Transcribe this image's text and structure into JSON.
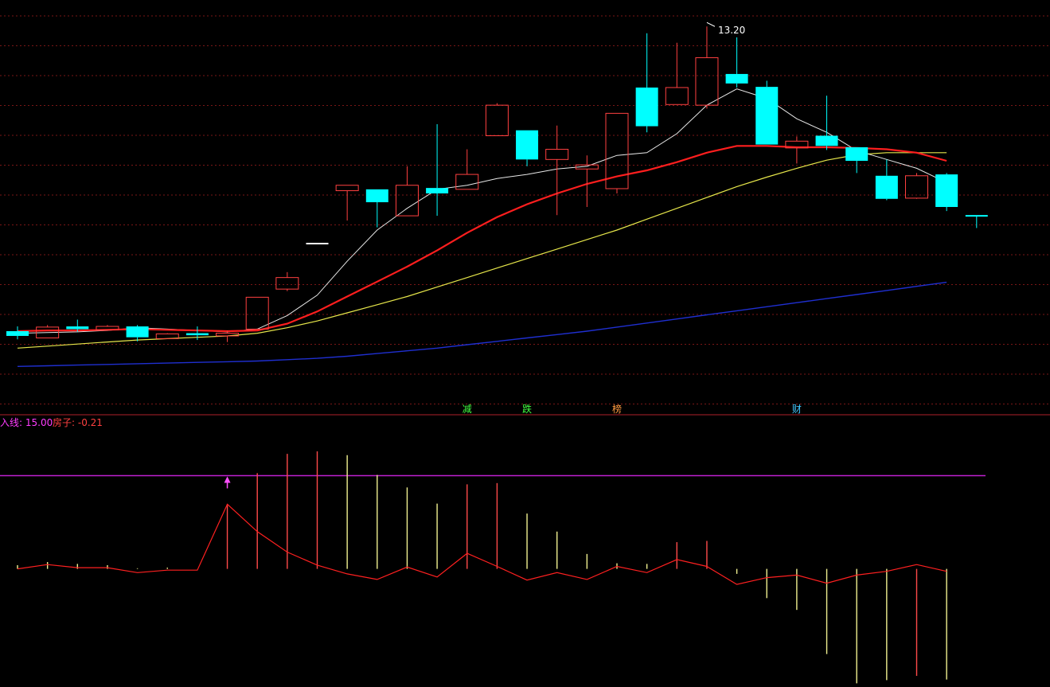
{
  "colors": {
    "background": "#000000",
    "grid": "#7a1616",
    "divider": "#b0202a",
    "up": "#ff4040",
    "down": "#00ffff",
    "ma5": "#e8e8e8",
    "ma10": "#ff1e1e",
    "ma20": "#e6e64a",
    "ma60": "#1f2fd0",
    "sub_line": "#ff2020",
    "ref_line": "#c020d0",
    "bar_up": "#ff4a4a",
    "bar_yellow": "#f0f090",
    "marker": "#ff50ff",
    "label_magenta": "#ff3cff",
    "label_red": "#ff4040"
  },
  "indicator_legend": {
    "entry_label": "入线: 15.00",
    "house_label": "房子: -0.21"
  },
  "price_high_label": "13.20",
  "signal_labels": [
    {
      "text": "减",
      "color": "#40ff40",
      "index": 15
    },
    {
      "text": "跌",
      "color": "#40ff40",
      "index": 17
    },
    {
      "text": "榜",
      "color": "#ff9a40",
      "index": 20
    },
    {
      "text": "财",
      "color": "#40c8ff",
      "index": 26
    }
  ],
  "chart_data": [
    {
      "type": "candlestick",
      "title": "",
      "ylim": [
        7.25,
        13.35
      ],
      "candles": [
        {
          "o": 8.47,
          "h": 8.54,
          "l": 8.35,
          "c": 8.4
        },
        {
          "o": 8.37,
          "h": 8.56,
          "l": 8.37,
          "c": 8.53
        },
        {
          "o": 8.54,
          "h": 8.64,
          "l": 8.46,
          "c": 8.5
        },
        {
          "o": 8.49,
          "h": 8.56,
          "l": 8.49,
          "c": 8.54
        },
        {
          "o": 8.54,
          "h": 8.56,
          "l": 8.32,
          "c": 8.38
        },
        {
          "o": 8.36,
          "h": 8.44,
          "l": 8.36,
          "c": 8.43
        },
        {
          "o": 8.44,
          "h": 8.54,
          "l": 8.34,
          "c": 8.41
        },
        {
          "o": 8.4,
          "h": 8.48,
          "l": 8.31,
          "c": 8.44
        },
        {
          "o": 8.5,
          "h": 8.97,
          "l": 8.5,
          "c": 8.97
        },
        {
          "o": 9.09,
          "h": 9.34,
          "l": 9.06,
          "c": 9.26
        },
        {
          "o": 9.76,
          "h": 9.76,
          "l": 9.76,
          "c": 9.76
        },
        {
          "o": 10.54,
          "h": 10.62,
          "l": 10.1,
          "c": 10.62
        },
        {
          "o": 10.56,
          "h": 10.56,
          "l": 10.0,
          "c": 10.37
        },
        {
          "o": 10.17,
          "h": 10.9,
          "l": 10.17,
          "c": 10.62
        },
        {
          "o": 10.58,
          "h": 11.52,
          "l": 10.17,
          "c": 10.5
        },
        {
          "o": 10.56,
          "h": 11.15,
          "l": 10.56,
          "c": 10.78
        },
        {
          "o": 11.35,
          "h": 11.83,
          "l": 11.35,
          "c": 11.8
        },
        {
          "o": 11.43,
          "h": 11.43,
          "l": 10.9,
          "c": 11.0
        },
        {
          "o": 11.0,
          "h": 11.5,
          "l": 10.18,
          "c": 11.15
        },
        {
          "o": 10.86,
          "h": 11.06,
          "l": 10.3,
          "c": 10.92
        },
        {
          "o": 10.57,
          "h": 11.68,
          "l": 10.5,
          "c": 11.68
        },
        {
          "o": 12.06,
          "h": 12.86,
          "l": 11.4,
          "c": 11.49
        },
        {
          "o": 11.81,
          "h": 12.72,
          "l": 11.81,
          "c": 12.06
        },
        {
          "o": 11.8,
          "h": 12.96,
          "l": 11.75,
          "c": 12.5
        },
        {
          "o": 12.26,
          "h": 12.8,
          "l": 12.06,
          "c": 12.12
        },
        {
          "o": 12.07,
          "h": 12.16,
          "l": 11.22,
          "c": 11.22
        },
        {
          "o": 11.17,
          "h": 11.34,
          "l": 10.94,
          "c": 11.27
        },
        {
          "o": 11.35,
          "h": 11.94,
          "l": 11.14,
          "c": 11.2
        },
        {
          "o": 11.18,
          "h": 11.16,
          "l": 10.8,
          "c": 10.98
        },
        {
          "o": 10.76,
          "h": 11.0,
          "l": 10.4,
          "c": 10.42
        },
        {
          "o": 10.43,
          "h": 10.8,
          "l": 10.42,
          "c": 10.76
        },
        {
          "o": 10.78,
          "h": 10.8,
          "l": 10.24,
          "c": 10.3
        },
        {
          "o": 10.17,
          "h": 10.17,
          "l": 9.99,
          "c": 10.16
        }
      ],
      "ma5": [
        8.44,
        8.45,
        8.46,
        8.48,
        8.52,
        8.5,
        8.48,
        8.46,
        8.5,
        8.7,
        9.0,
        9.5,
        9.96,
        10.28,
        10.56,
        10.62,
        10.72,
        10.78,
        10.86,
        10.9,
        11.06,
        11.1,
        11.38,
        11.8,
        12.04,
        11.9,
        11.6,
        11.4,
        11.13,
        11.0,
        10.87,
        10.66
      ],
      "ma10": [
        8.47,
        8.48,
        8.48,
        8.49,
        8.5,
        8.49,
        8.48,
        8.47,
        8.48,
        8.58,
        8.76,
        8.98,
        9.2,
        9.42,
        9.66,
        9.92,
        10.15,
        10.34,
        10.5,
        10.64,
        10.75,
        10.84,
        10.96,
        11.1,
        11.2,
        11.2,
        11.18,
        11.18,
        11.17,
        11.15,
        11.1,
        10.98
      ],
      "ma20": [
        8.22,
        8.25,
        8.28,
        8.31,
        8.34,
        8.36,
        8.38,
        8.4,
        8.44,
        8.52,
        8.62,
        8.74,
        8.86,
        8.98,
        9.12,
        9.26,
        9.4,
        9.54,
        9.68,
        9.82,
        9.96,
        10.12,
        10.28,
        10.44,
        10.6,
        10.74,
        10.87,
        10.99,
        11.07,
        11.1,
        11.1,
        11.1
      ],
      "ma60": [
        7.95,
        7.96,
        7.97,
        7.98,
        7.99,
        8.0,
        8.01,
        8.02,
        8.03,
        8.05,
        8.07,
        8.1,
        8.14,
        8.18,
        8.22,
        8.27,
        8.32,
        8.37,
        8.42,
        8.47,
        8.53,
        8.59,
        8.65,
        8.71,
        8.77,
        8.83,
        8.89,
        8.95,
        9.01,
        9.07,
        9.13,
        9.19
      ]
    },
    {
      "type": "bar+line",
      "title": "",
      "ylim": [
        -19,
        23
      ],
      "reference_line": 15.0,
      "line": [
        0.0,
        0.7,
        0.2,
        0.2,
        -0.6,
        -0.2,
        -0.2,
        10.4,
        6.0,
        2.7,
        0.6,
        -0.8,
        -1.7,
        0.3,
        -1.3,
        2.5,
        0.4,
        -1.8,
        -0.6,
        -1.7,
        0.4,
        -0.6,
        1.5,
        0.4,
        -2.5,
        -1.4,
        -1.0,
        -2.3,
        -1.0,
        -0.4,
        0.7,
        -0.4
      ],
      "bars": [
        {
          "v": 0.6,
          "c": "y"
        },
        {
          "v": 1.1,
          "c": "y"
        },
        {
          "v": 0.8,
          "c": "y"
        },
        {
          "v": 0.6,
          "c": "y"
        },
        {
          "v": 0.1,
          "c": "y"
        },
        {
          "v": 0.2,
          "c": "y"
        },
        {
          "v": 0.0,
          "c": "y"
        },
        {
          "v": 10.4,
          "c": "r"
        },
        {
          "v": 15.4,
          "c": "r"
        },
        {
          "v": 18.5,
          "c": "r"
        },
        {
          "v": 18.9,
          "c": "r"
        },
        {
          "v": 18.3,
          "c": "y"
        },
        {
          "v": 15.1,
          "c": "y"
        },
        {
          "v": 13.1,
          "c": "y"
        },
        {
          "v": 10.5,
          "c": "y"
        },
        {
          "v": 13.6,
          "c": "r"
        },
        {
          "v": 13.8,
          "c": "r"
        },
        {
          "v": 8.9,
          "c": "y"
        },
        {
          "v": 6.0,
          "c": "y"
        },
        {
          "v": 2.4,
          "c": "y"
        },
        {
          "v": 0.9,
          "c": "y"
        },
        {
          "v": 0.8,
          "c": "y"
        },
        {
          "v": 4.3,
          "c": "r"
        },
        {
          "v": 4.5,
          "c": "r"
        },
        {
          "v": -0.8,
          "c": "y"
        },
        {
          "v": -4.7,
          "c": "y"
        },
        {
          "v": -6.6,
          "c": "y"
        },
        {
          "v": -13.7,
          "c": "y"
        },
        {
          "v": -18.4,
          "c": "y"
        },
        {
          "v": -17.9,
          "c": "y"
        },
        {
          "v": -17.2,
          "c": "r"
        },
        {
          "v": -17.8,
          "c": "y"
        }
      ],
      "markers": [
        {
          "index": 7,
          "type": "up-arrow"
        }
      ]
    }
  ]
}
